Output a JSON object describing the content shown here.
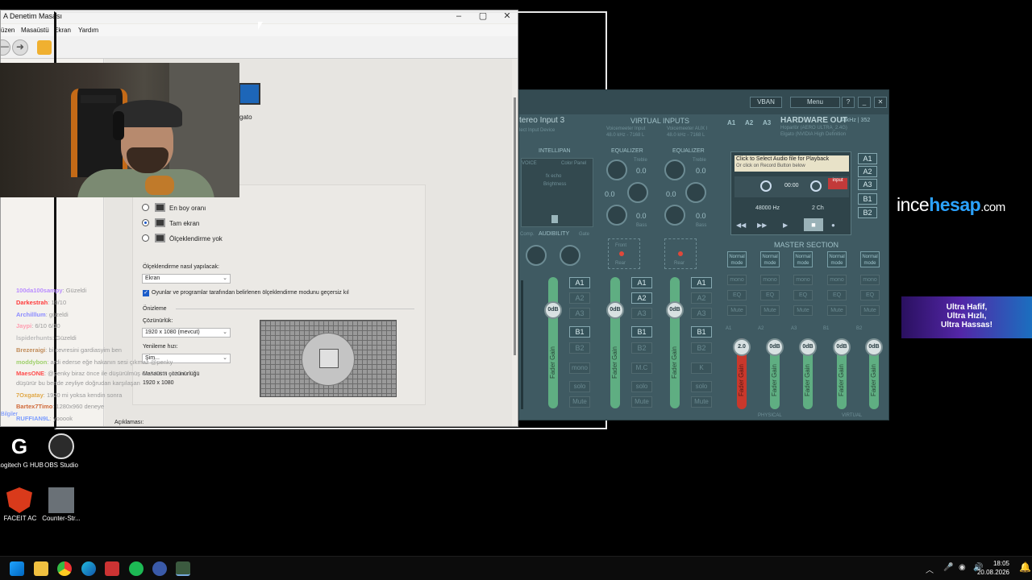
{
  "control_panel": {
    "title": "A Denetim Masası",
    "menu": [
      "üzen",
      "Masaüstü",
      "Ekran",
      "Yardım"
    ],
    "device_label": "gato",
    "scale_options": [
      {
        "label": "En boy oranı",
        "selected": false
      },
      {
        "label": "Tam ekran",
        "selected": true
      },
      {
        "label": "Ölçeklendirme yok",
        "selected": false
      }
    ],
    "scaling_method_label": "Ölçeklendirme nasıl yapılacak:",
    "scaling_method_value": "Ekran",
    "override_checkbox_label": "Oyunlar ve programlar tarafından belirlenen ölçeklendirme modunu geçersiz kıl",
    "preview_label": "Önizleme",
    "resolution_label": "Çözünürlük:",
    "resolution_value": "1920 x 1080 (mevcut)",
    "refresh_label": "Yenileme hızı:",
    "refresh_value": "Şim...",
    "desktop_res_label": "Masaüstü çözünürlüğü",
    "desktop_res_value": "1920 x 1080",
    "description_label": "Açıklaması:",
    "left_label": "Bilgiler"
  },
  "chat": [
    {
      "user": "100da100sampy",
      "msg": ": Güzeldi",
      "color": "#b98cff"
    },
    {
      "user": "Darkestrah",
      "msg": ": 10/10",
      "color": "#ff3b3b"
    },
    {
      "user": "Archilllum",
      "msg": ": güzeldi",
      "color": "#8b8bff"
    },
    {
      "user": "Jaypi",
      "msg": ": 6/10 6/10",
      "color": "#ff9db0"
    },
    {
      "user": "lspiderhunts",
      "msg": ": Güzeldi",
      "color": "#bbbbbb"
    },
    {
      "user": "Brezeraigi",
      "msg": ": bi cevresini gardiasyim ben",
      "color": "#c18c5a"
    },
    {
      "user": "moddybon",
      "msg": ": ardi ederse eğe hakanın sesi çıkmaz @penky",
      "color": "#9fd06b"
    },
    {
      "user": "MaesONE",
      "msg": ": @penky biraz önce ile düşürülmüş de 540hz aldı bi",
      "color": "#ff4c4c"
    },
    {
      "user": "",
      "msg": "düşürür bu bende zeyliye doğrudan karşılaşan",
      "color": "#9a9a9a"
    },
    {
      "user": "7Oxgatay",
      "msg": ": 1920 mi yoksa kendin sonra",
      "color": "#e0a848"
    },
    {
      "user": "Bartex7Timo",
      "msg": ": 1280x960 deneye",
      "color": "#d06a3a"
    },
    {
      "user": "RUFFIAN9L",
      "msg": ": yooook",
      "color": "#7a9cff"
    }
  ],
  "voicemeeter": {
    "vban_label": "VBAN",
    "menu_label": "Menu",
    "help_label": "?",
    "stereo_input_title": "tereo Input 3",
    "stereo_input_sub": "lect Input Device",
    "virtual_inputs_title": "VIRTUAL INPUTS",
    "vi1_name": "Voicemeeter Input",
    "vi1_rate": "48.0 kHz - 7168 L",
    "vi2_name": "Voicemeeter AUX I",
    "vi2_rate": "48.0 kHz - 7168 L",
    "a_buttons": [
      "A1",
      "A2",
      "A3"
    ],
    "hw_out_title": "HARDWARE OUT",
    "hw_out_rate": "48kHz | 352",
    "hw_out_dev1": "Hoparlör (AERO ULTRA_2.4G)",
    "hw_out_dev2": "Elgato (NVIDIA High Definition",
    "intellipan": "INTELLIPAN",
    "voice": "VOICE",
    "color_panel": "Color Panel",
    "fx_echo": "fx echo",
    "brightness": "Brightness",
    "comp": "Comp.",
    "audibility": "AUDIBILITY",
    "gate": "Gate",
    "equalizer": "EQUALIZER",
    "treble": "Treble",
    "bass": "Bass",
    "eq_val": "0.0",
    "player_line1": "Click to Select Audio file for Playback",
    "player_line2": "Or click on Record Button below",
    "player_time": "00:00",
    "player_input": "input",
    "player_rate": "48000 Hz",
    "player_ch": "2 Ch",
    "master_section": "MASTER SECTION",
    "normal_mode": "Normal mode",
    "mono": "mono",
    "eq": "EQ",
    "mute": "Mute",
    "solo": "solo",
    "mc": "M.C",
    "k": "K",
    "fader_gain": "Fader Gain",
    "odb": "0dB",
    "red_gain": "2.0",
    "physical": "PHYSICAL",
    "virtual": "VIRTUAL",
    "front": "Front",
    "rear": "Rear",
    "master_labels": [
      "A1",
      "A2",
      "A3",
      "B1",
      "B2"
    ]
  },
  "desktop": {
    "icons": [
      {
        "label": "Logitech G HUB"
      },
      {
        "label": "OBS Studio"
      },
      {
        "label": "FACEIT AC"
      },
      {
        "label": "Counter-Str..."
      }
    ],
    "brand_pre": "ince",
    "brand_bold": "hesap",
    "brand_post": ".com",
    "ad_line1": "Ultra Hafif,",
    "ad_line2": "Ultra Hızlı,",
    "ad_line3": "Ultra Hassas!"
  },
  "taskbar": {
    "time": "18:05",
    "date": "20.08.2026"
  }
}
